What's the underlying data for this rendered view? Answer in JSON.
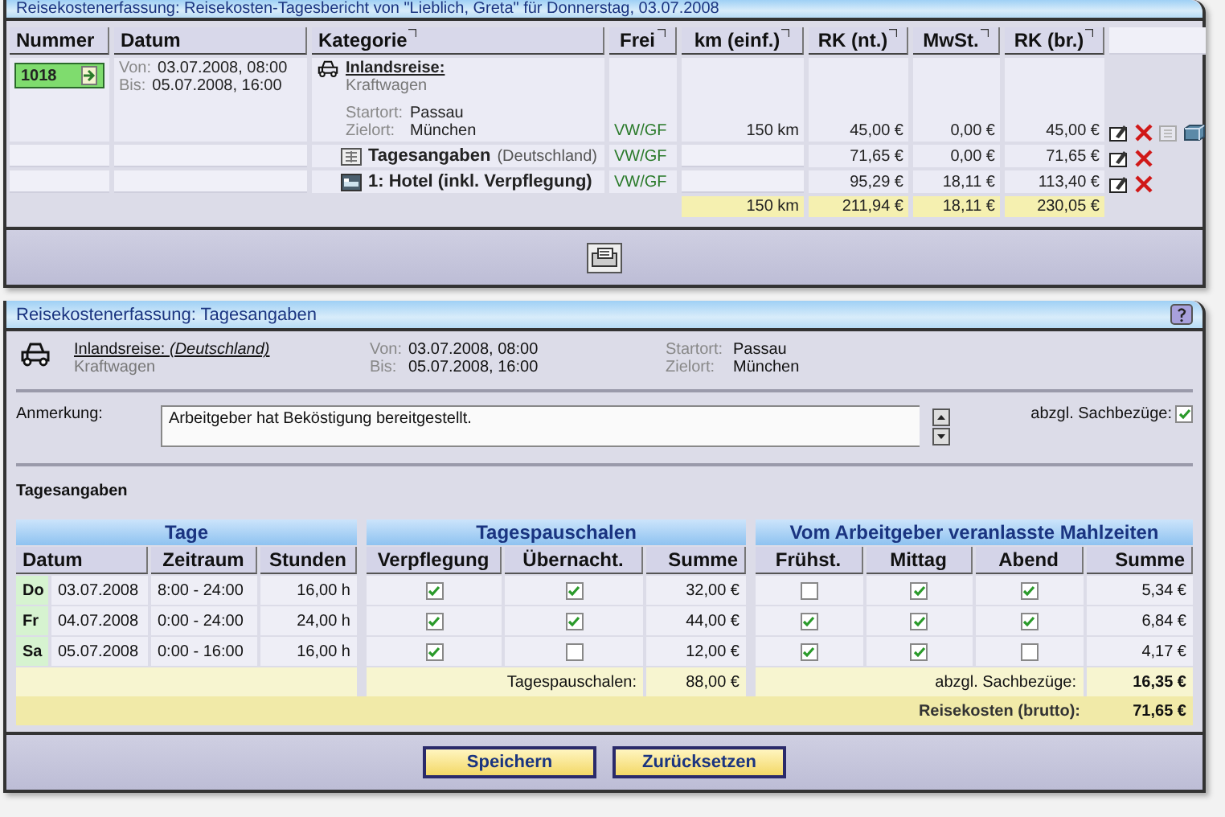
{
  "report_window": {
    "title": "Reisekostenerfassung: Reisekosten-Tagesbericht von \"Lieblich, Greta\" für Donnerstag, 03.07.2008",
    "columns": [
      {
        "label": "Nummer",
        "sortable": false
      },
      {
        "label": "Datum",
        "sortable": false
      },
      {
        "label": "Kategorie",
        "sortable": true
      },
      {
        "label": "Frei",
        "sortable": true
      },
      {
        "label": "km (einf.)",
        "sortable": true
      },
      {
        "label": "RK (nt.)",
        "sortable": true
      },
      {
        "label": "MwSt.",
        "sortable": true
      },
      {
        "label": "RK (br.)",
        "sortable": true
      }
    ],
    "trip": {
      "number": "1018",
      "from_label": "Von:",
      "from": "03.07.2008, 08:00",
      "to_label": "Bis:",
      "to": "05.07.2008, 16:00",
      "category": "Inlandsreise:",
      "vehicle": "Kraftwagen",
      "start_label": "Startort:",
      "start": "Passau",
      "dest_label": "Zielort:",
      "dest": "München"
    },
    "entries": [
      {
        "kind": "trip",
        "frei": "VW/GF",
        "km": "150 km",
        "net": "45,00 €",
        "vat": "0,00 €",
        "gross": "45,00 €"
      },
      {
        "kind": "daily",
        "label": "Tagesangaben",
        "detail": "(Deutschland)",
        "frei": "VW/GF",
        "net": "71,65 €",
        "vat": "0,00 €",
        "gross": "71,65 €"
      },
      {
        "kind": "hotel",
        "label": "1:  Hotel (inkl. Verpflegung)",
        "frei": "VW/GF",
        "net": "95,29 €",
        "vat": "18,11 €",
        "gross": "113,40 €"
      }
    ],
    "totals": {
      "km": "150 km",
      "net": "211,94 €",
      "vat": "18,11 €",
      "gross": "230,05 €"
    }
  },
  "daily_window": {
    "title": "Reisekostenerfassung: Tagesangaben",
    "trip": {
      "category": "Inlandsreise: *(Deutschland)*",
      "vehicle": "Kraftwagen",
      "from_label": "Von:",
      "from": "03.07.2008, 08:00",
      "to_label": "Bis:",
      "to": "05.07.2008, 16:00",
      "start_label": "Startort:",
      "start": "Passau",
      "dest_label": "Zielort:",
      "dest": "München"
    },
    "remark": {
      "label": "Anmerkung:",
      "value": "Arbeitgeber hat Beköstigung bereitgestellt."
    },
    "deduct": {
      "label": "abzgl. Sachbezüge:",
      "checked": true
    },
    "section_title": "Tagesangaben",
    "groups": [
      {
        "title": "Tage",
        "columns": [
          "Datum",
          "Zeitraum",
          "Stunden"
        ]
      },
      {
        "title": "Tagespauschalen",
        "columns": [
          "Verpflegung",
          "Übernacht.",
          "Summe"
        ]
      },
      {
        "title": "Vom Arbeitgeber veranlasste Mahlzeiten",
        "columns": [
          "Frühst.",
          "Mittag",
          "Abend",
          "Summe"
        ]
      }
    ],
    "days": [
      {
        "weekday": "Do",
        "date": "03.07.2008",
        "period": "8:00 - 24:00",
        "hours": "16,00 h",
        "meals_allowance": true,
        "overnight": true,
        "allowance": "32,00 €",
        "breakfast": false,
        "lunch": true,
        "dinner": true,
        "meal_sum": "5,34 €"
      },
      {
        "weekday": "Fr",
        "date": "04.07.2008",
        "period": "0:00 - 24:00",
        "hours": "24,00 h",
        "meals_allowance": true,
        "overnight": true,
        "allowance": "44,00 €",
        "breakfast": true,
        "lunch": true,
        "dinner": true,
        "meal_sum": "6,84 €"
      },
      {
        "weekday": "Sa",
        "date": "05.07.2008",
        "period": "0:00 - 16:00",
        "hours": "16,00 h",
        "meals_allowance": true,
        "overnight": false,
        "allowance": "12,00 €",
        "breakfast": true,
        "lunch": true,
        "dinner": false,
        "meal_sum": "4,17 €"
      }
    ],
    "summary": [
      {
        "label": "Tagespauschalen:",
        "value": "88,00 €"
      },
      {
        "label": "abzgl. Sachbezüge:",
        "value": "16,35 €"
      },
      {
        "label": "Reisekosten (brutto):",
        "value": "71,65 €"
      }
    ],
    "buttons": [
      "Speichern",
      "Zurücksetzen"
    ]
  }
}
